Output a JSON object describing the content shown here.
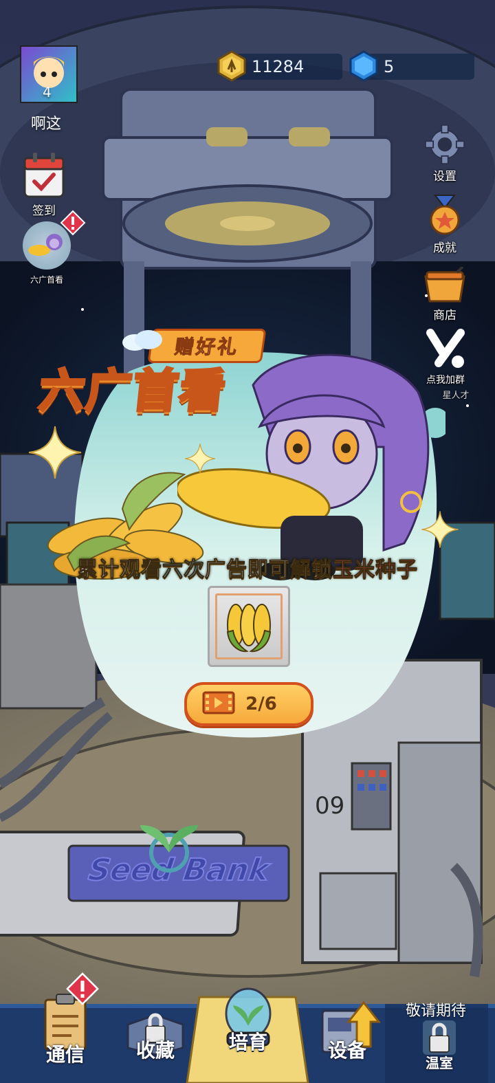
{
  "player": {
    "level": "4",
    "name": "啊这"
  },
  "currency": {
    "coins": "11284",
    "gems": "5"
  },
  "left_menu": {
    "checkin_label": "签到",
    "promo_label": "六广首看"
  },
  "right_menu": {
    "settings_label": "设置",
    "achievements_label": "成就",
    "shop_label": "商店",
    "group_label": "点我加群",
    "group_sub_label": "星人才"
  },
  "popup": {
    "ribbon": "赠好礼",
    "title": "六广首看",
    "desc_prefix": "累计观看",
    "desc_count": "六次",
    "desc_middle": "广告即可解锁",
    "desc_reward": "玉米种子",
    "progress": "2/6"
  },
  "scene": {
    "machine_number": "09",
    "bank_sign": "Seed Bank"
  },
  "bottom_nav": {
    "comm": "通信",
    "collection": "收藏",
    "cultivate": "培育",
    "equipment": "设备",
    "greenhouse": "温室",
    "coming_soon": "敬请期待"
  },
  "colors": {
    "accent_orange": "#f6a93a",
    "highlight_blue": "#5ec8ff",
    "highlight_red": "#ff5a6a"
  }
}
